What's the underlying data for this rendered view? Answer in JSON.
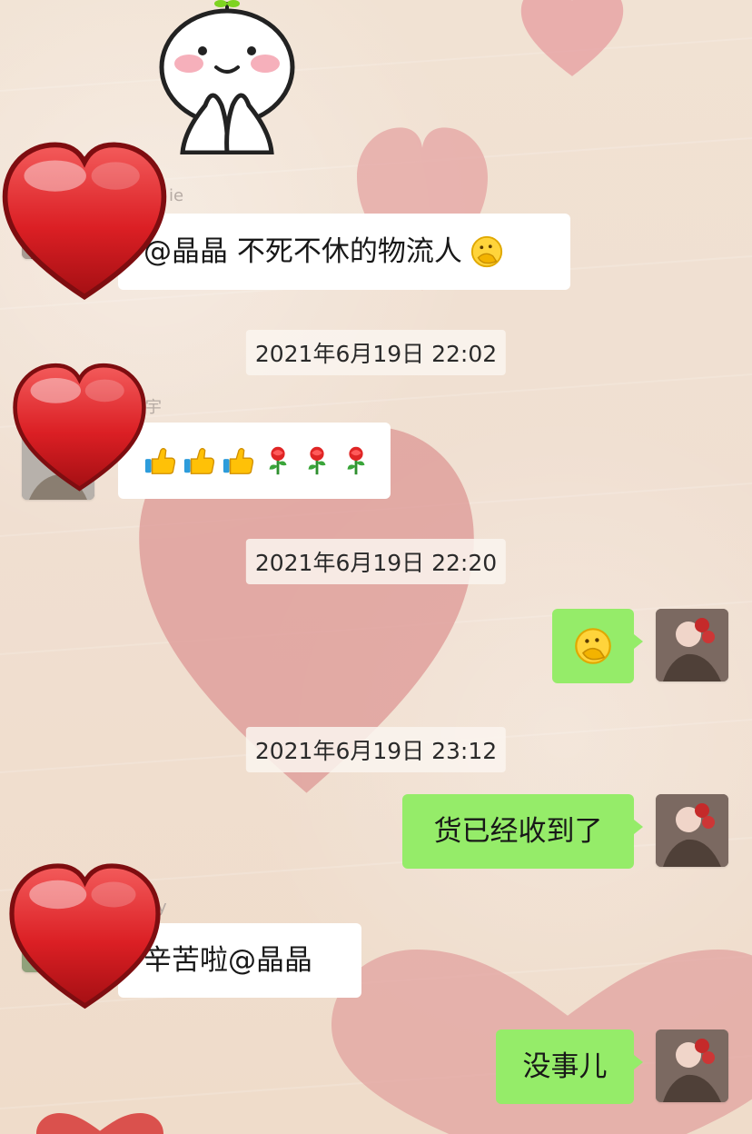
{
  "messages": [
    {
      "type": "incoming",
      "name_fragment": "ie",
      "text": "@晶晶   不死不休的物流人",
      "trailing_icon": "hand-over-mouth-icon"
    },
    {
      "type": "timestamp",
      "text": "2021年6月19日 22:02"
    },
    {
      "type": "incoming",
      "name_fragment": "宇",
      "icons": [
        "thumbs-up-icon",
        "thumbs-up-icon",
        "thumbs-up-icon",
        "rose-icon",
        "rose-icon",
        "rose-icon"
      ]
    },
    {
      "type": "timestamp",
      "text": "2021年6月19日 22:20"
    },
    {
      "type": "outgoing",
      "icon": "hand-over-mouth-icon"
    },
    {
      "type": "timestamp",
      "text": "2021年6月19日 23:12"
    },
    {
      "type": "outgoing",
      "text": "货已经收到了"
    },
    {
      "type": "incoming",
      "name_fragment": "y",
      "text": "辛苦啦@晶晶"
    },
    {
      "type": "outgoing",
      "text": "没事儿"
    }
  ],
  "decorations": {
    "background_hearts": "pink-heart-brush",
    "sticker": "white-dumpling-praying-sticker",
    "avatar_overlays": "red-heart-icon"
  },
  "colors": {
    "incoming_bubble": "#ffffff",
    "outgoing_bubble": "#95ec69",
    "timestamp_bg": "#faf4ef",
    "background": "#f2e4d6"
  }
}
